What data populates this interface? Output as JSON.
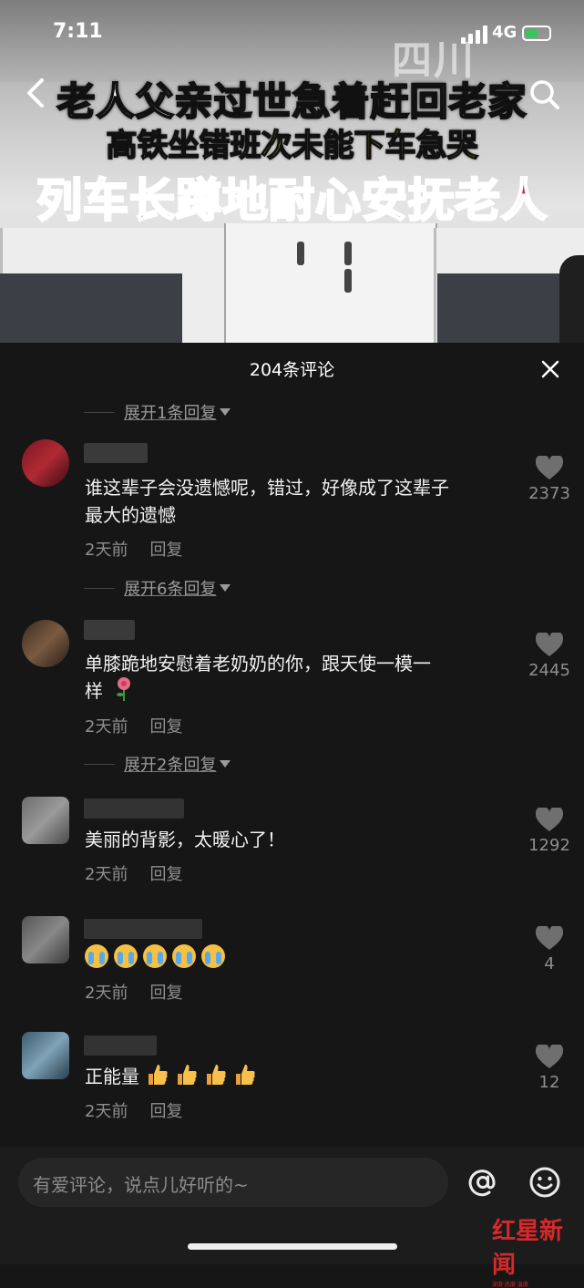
{
  "status": {
    "time": "7:11",
    "network": "4G"
  },
  "video": {
    "watermark": "四川",
    "headline_1": "老人父亲过世急着赶回老家",
    "headline_2": "高铁坐错班次未能下车急哭",
    "headline_3": "列车长蹲地耐心安抚老人"
  },
  "comments_panel": {
    "title": "204条评论",
    "comments": [
      {
        "expand_before": "展开1条回复",
        "text_1": "谁这辈子会没遗憾呢，错过，好像成了这辈子",
        "text_2": "最大的遗憾",
        "time": "2天前",
        "reply": "回复",
        "likes": "2373"
      },
      {
        "expand_before": "展开6条回复",
        "text_1": "单膝跪地安慰着老奶奶的你，跟天使一模一",
        "text_2": "样",
        "emoji": "rose-emoji",
        "time": "2天前",
        "reply": "回复",
        "likes": "2445"
      },
      {
        "expand_before": "展开2条回复",
        "text_1": "美丽的背影，太暖心了！",
        "time": "2天前",
        "reply": "回复",
        "likes": "1292"
      },
      {
        "emoji": "crying-face-emoji",
        "emoji_count": 5,
        "time": "2天前",
        "reply": "回复",
        "likes": "4"
      },
      {
        "text_1": "正能量",
        "emoji": "thumbs-up-emoji",
        "emoji_count": 4,
        "time": "2天前",
        "reply": "回复",
        "likes": "12"
      }
    ]
  },
  "input_bar": {
    "placeholder": "有爱评论，说点儿好听的~"
  },
  "logo": {
    "brand": "红星新闻",
    "tagline": "深度·态度·温度"
  },
  "colors": {
    "panel_bg": "#161616",
    "meta_text": "#8e8e8e",
    "headline_yellow": "#ffe31a",
    "headline_red": "#e3261f",
    "brand_red": "#d8282a"
  }
}
